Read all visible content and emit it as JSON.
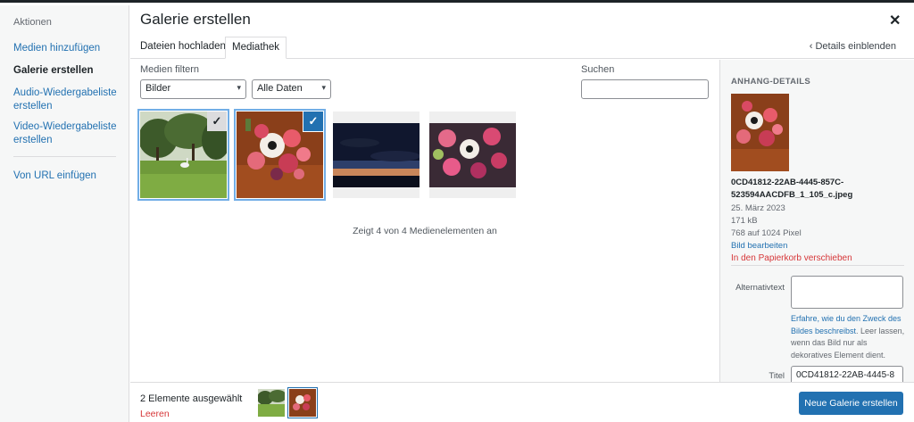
{
  "menu": {
    "heading": "Aktionen",
    "items": [
      {
        "label": "Medien hinzufügen"
      },
      {
        "label": "Galerie erstellen"
      },
      {
        "label": "Audio-Wiedergabeliste erstellen"
      },
      {
        "label": "Video-Wiedergabeliste erstellen"
      },
      {
        "label": "Von URL einfügen"
      }
    ]
  },
  "header": {
    "title": "Galerie erstellen",
    "close_icon": "close-icon"
  },
  "tabs": [
    {
      "label": "Dateien hochladen"
    },
    {
      "label": "Mediathek"
    }
  ],
  "details_toggle": "Details einblenden",
  "filters": {
    "label": "Medien filtern",
    "type_value": "Bilder",
    "date_value": "Alle Daten",
    "search_label": "Suchen",
    "search_value": ""
  },
  "media": [
    {
      "subject": "park-with-swan",
      "selected": true,
      "active": false
    },
    {
      "subject": "flower-bouquet",
      "selected": true,
      "active": true
    },
    {
      "subject": "sunset-sky",
      "selected": false,
      "active": false
    },
    {
      "subject": "flower-bouquet-2",
      "selected": false,
      "active": false
    }
  ],
  "count_info": "Zeigt 4 von 4 Medienelementen an",
  "details": {
    "heading": "ANHANG-DETAILS",
    "filename": "0CD41812-22AB-4445-857C-523594AACDFB_1_105_c.jpeg",
    "date": "25. März 2023",
    "size": "171 kB",
    "dimensions": "768 auf 1024 Pixel",
    "edit_link": "Bild bearbeiten",
    "trash_link": "In den Papierkorb verschieben",
    "alt_label": "Alternativtext",
    "alt_value": "",
    "help_link": "Erfahre, wie du den Zweck des Bildes beschreibst",
    "help_rest": ". Leer lassen, wenn das Bild nur als dekoratives Element dient.",
    "title_label": "Titel",
    "title_value": "0CD41812-22AB-4445-8"
  },
  "footer": {
    "selected_count": "2 Elemente ausgewählt",
    "clear_label": "Leeren",
    "create_button": "Neue Galerie erstellen"
  },
  "colors": {
    "accent": "#2271b1",
    "danger": "#d63638",
    "selection": "#72aee6"
  }
}
